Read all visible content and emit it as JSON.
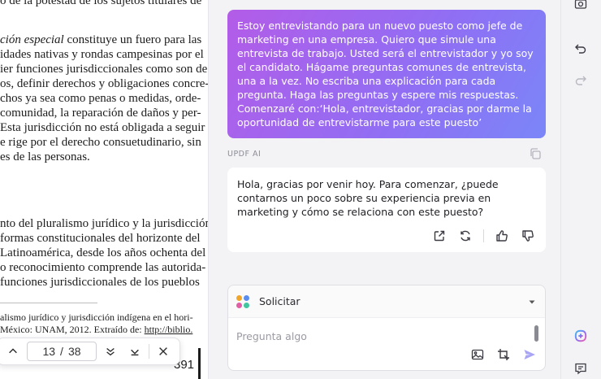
{
  "document": {
    "lines": [
      {
        "text": "o de la potestad de los sujetos titulares de",
        "style": "top"
      },
      {
        "italic": "ción especial",
        "text": " constituye un fuero para las"
      },
      {
        "text": "idades nativas y rondas campesinas por el"
      },
      {
        "text": "ier funciones jurisdiccionales como son de"
      },
      {
        "text": "os, definir derechos y obligaciones concre-"
      },
      {
        "text": "chos ya sea como penas o medidas,  orde-"
      },
      {
        "text": " comunidad, la reparación de daños y per-"
      },
      {
        "text": "Esta jurisdicción no está obligada a seguir"
      },
      {
        "text": "e rige por el derecho consuetudinario, sin"
      },
      {
        "text": "es de las personas."
      },
      {
        "text": "nto del pluralismo jurídico y la jurisdicción"
      },
      {
        "text": "formas constitucionales del horizonte del"
      },
      {
        "text": "Latinoamérica, desde los años ochenta del"
      },
      {
        "text": "o reconocimiento comprende las autorida-"
      },
      {
        "text": " funciones jurisdiccionales de los pueblos"
      }
    ],
    "footnote": [
      {
        "text": "alismo jurídico y jurisdicción indígena en el hori-"
      },
      {
        "text": "México: UNAM, 2012. Extraído de: ",
        "link": "http://biblio."
      }
    ],
    "page_number": "391"
  },
  "page_nav": {
    "current_page": "13",
    "separator": "/",
    "total_pages": "38"
  },
  "chat": {
    "user_message": "Estoy  entrevistando para un nuevo puesto como jefe de marketing en una empresa. Quiero que simule una entrevista de trabajo. Usted será el entrevistador y yo soy el candidato. Hágame preguntas comunes de entrevista, una a la vez. No escriba una explicación para cada pregunta. Haga las preguntas y espere mis respuestas. Comenzaré con:‘Hola, entrevistador, gracias por darme la oportunidad de entrevistarme para este puesto’",
    "ai_label": "UPDF AI",
    "ai_message": "Hola, gracias por venir hoy. Para comenzar, ¿puede contarnos un poco sobre su experiencia previa en marketing y cómo se relaciona con este puesto?",
    "prompt_label": "Solicitar",
    "input_placeholder": "Pregunta algo",
    "colors": {
      "user_bubble_start": "#b35ce8",
      "user_bubble_end": "#7b86f8",
      "send_button": "#a8a4f6",
      "ai_brand": "#5b8def"
    }
  },
  "icons": {
    "nav": [
      "chevron-up-icon",
      "chevron-double-down-icon",
      "chevron-down-icon",
      "close-icon"
    ],
    "ai_actions": [
      "share-icon",
      "regenerate-icon",
      "thumbs-up-icon",
      "thumbs-down-icon"
    ],
    "input_tools": [
      "image-icon",
      "crop-icon",
      "send-icon"
    ],
    "rail": [
      "camera-icon",
      "undo-icon",
      "redo-icon",
      "updf-ai-icon",
      "comment-icon"
    ]
  }
}
